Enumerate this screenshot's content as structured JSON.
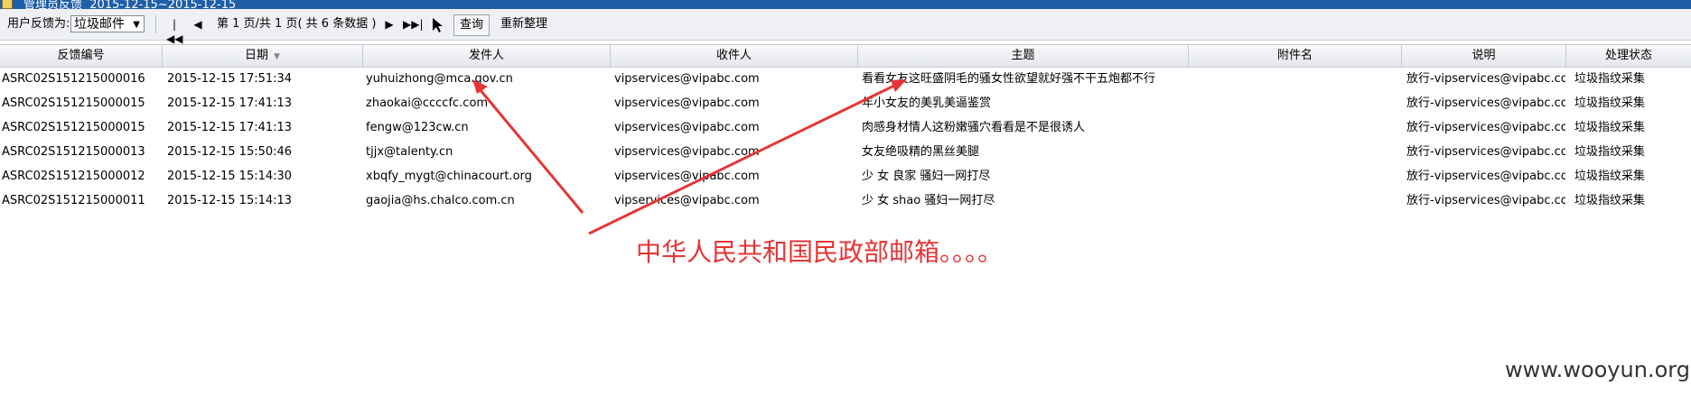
{
  "window": {
    "title": "管理员反馈",
    "date_range": "2015-12-15~2015-12-15"
  },
  "toolbar": {
    "filter_label": "用户反馈为:",
    "filter_value": "垃圾邮件",
    "first_page_icon": "first-page-icon",
    "prev_page_icon": "prev-page-icon",
    "next_page_icon": "next-page-icon",
    "last_page_icon": "last-page-icon",
    "page_info": "第 1 页/共 1 页( 共 6 条数据 )",
    "query_label": "查询",
    "reorganize_label": "重新整理"
  },
  "table": {
    "columns": [
      "反馈编号",
      "日期",
      "发件人",
      "收件人",
      "主题",
      "附件名",
      "说明",
      "处理状态"
    ],
    "rows": [
      [
        "ASRC02S151215000016",
        "2015-12-15 17:51:34",
        "yuhuizhong@mca.gov.cn",
        "vipservices@vipabc.com",
        "看看女友这旺盛阴毛的骚女性欲望就好强不干五炮都不行",
        "",
        "放行-vipservices@vipabc.com",
        "垃圾指纹采集"
      ],
      [
        "ASRC02S151215000015",
        "2015-12-15 17:41:13",
        "zhaokai@ccccfc.com",
        "vipservices@vipabc.com",
        "年小女友的美乳美逼鉴赏",
        "",
        "放行-vipservices@vipabc.com",
        "垃圾指纹采集"
      ],
      [
        "ASRC02S151215000015",
        "2015-12-15 17:41:13",
        "fengw@123cw.cn",
        "vipservices@vipabc.com",
        "肉感身材情人这粉嫩骚穴看看是不是很诱人",
        "",
        "放行-vipservices@vipabc.com",
        "垃圾指纹采集"
      ],
      [
        "ASRC02S151215000013",
        "2015-12-15 15:50:46",
        "tjjx@talenty.cn",
        "vipservices@vipabc.com",
        "女友绝吸精的黑丝美腿",
        "",
        "放行-vipservices@vipabc.com",
        "垃圾指纹采集"
      ],
      [
        "ASRC02S151215000012",
        "2015-12-15 15:14:30",
        "xbqfy_mygt@chinacourt.org",
        "vipservices@vipabc.com",
        "少 女 良家 骚妇一网打尽",
        "",
        "放行-vipservices@vipabc.com",
        "垃圾指纹采集"
      ],
      [
        "ASRC02S151215000011",
        "2015-12-15 15:14:13",
        "gaojia@hs.chalco.com.cn",
        "vipservices@vipabc.com",
        "少 女 shao 骚妇一网打尽",
        "",
        "放行-vipservices@vipabc.com",
        "垃圾指纹采集"
      ]
    ]
  },
  "annotation": {
    "text": "中华人民共和国民政部邮箱。。。。",
    "color": "#e53535"
  },
  "watermark": "www.wooyun.org"
}
